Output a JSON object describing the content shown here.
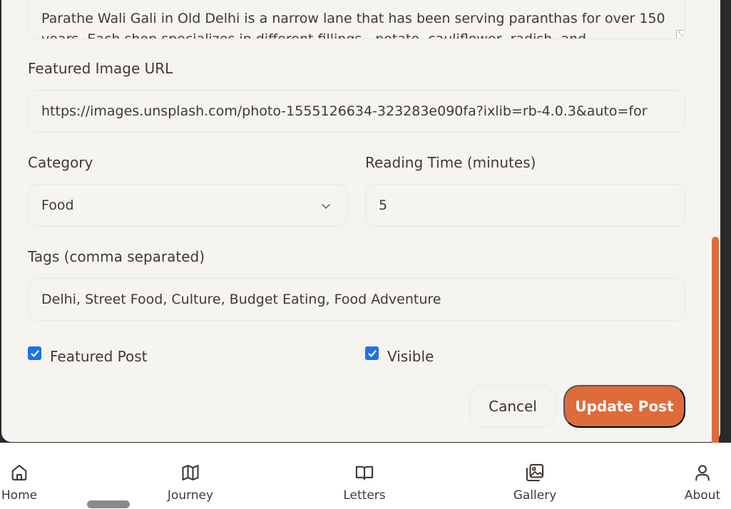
{
  "form": {
    "content_text": "Parathe Wali Gali in Old Delhi is a narrow lane that has been serving paranthas for over 150 years. Each shop specializes in different fillings - potato, cauliflower, radish, and",
    "featured_image_label": "Featured Image URL",
    "featured_image_value": "https://images.unsplash.com/photo-1555126634-323283e090fa?ixlib=rb-4.0.3&auto=for",
    "category_label": "Category",
    "category_value": "Food",
    "reading_time_label": "Reading Time (minutes)",
    "reading_time_value": "5",
    "tags_label": "Tags (comma separated)",
    "tags_value": "Delhi, Street Food, Culture, Budget Eating, Food Adventure",
    "featured_post_label": "Featured Post",
    "featured_post_checked": true,
    "visible_label": "Visible",
    "visible_checked": true,
    "cancel_label": "Cancel",
    "update_label": "Update Post"
  },
  "colors": {
    "accent": "#df6b3b",
    "background": "#f6f4f0",
    "checkbox": "#1a73e8"
  },
  "bottom_nav": {
    "items": [
      {
        "label": "Home",
        "icon": "home-icon"
      },
      {
        "label": "Journey",
        "icon": "map-icon"
      },
      {
        "label": "Letters",
        "icon": "book-open-icon"
      },
      {
        "label": "Gallery",
        "icon": "images-icon"
      },
      {
        "label": "About",
        "icon": "user-icon"
      }
    ]
  }
}
